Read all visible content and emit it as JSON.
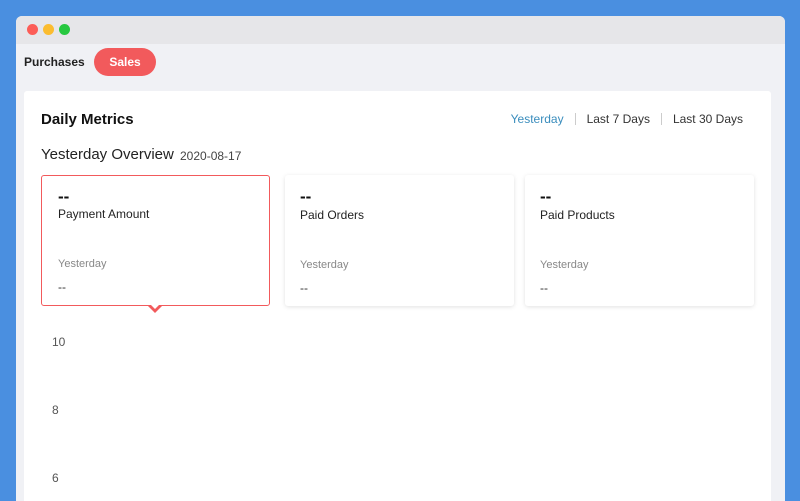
{
  "window": {
    "controls": [
      "close",
      "minimize",
      "maximize"
    ]
  },
  "topnav": {
    "purchases_label": "Purchases",
    "sales_label": "Sales",
    "active": "Sales",
    "accent_color": "#f25a5c"
  },
  "panel": {
    "title": "Daily Metrics",
    "range_tabs": [
      "Yesterday",
      "Last 7 Days",
      "Last 30 Days"
    ],
    "active_range": "Yesterday",
    "active_range_color": "#3a8dbd"
  },
  "overview": {
    "title": "Yesterday Overview",
    "date": "2020-08-17"
  },
  "cards": [
    {
      "value": "--",
      "label": "Payment Amount",
      "sub_label": "Yesterday",
      "sub_value": "--",
      "selected": true
    },
    {
      "value": "--",
      "label": "Paid Orders",
      "sub_label": "Yesterday",
      "sub_value": "--",
      "selected": false
    },
    {
      "value": "--",
      "label": "Paid Products",
      "sub_label": "Yesterday",
      "sub_value": "--",
      "selected": false
    }
  ],
  "chart": {
    "y_ticks": [
      "10",
      "8",
      "6"
    ]
  }
}
